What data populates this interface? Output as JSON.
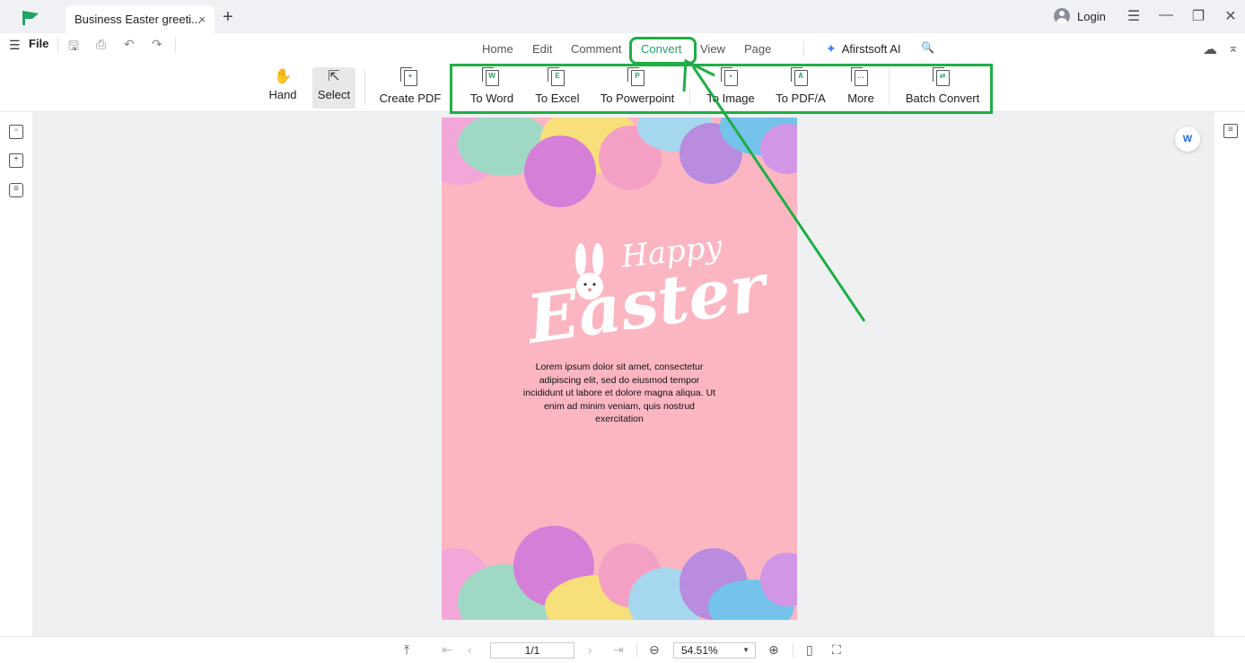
{
  "tab": {
    "title": "Business Easter greeti...",
    "close": "×"
  },
  "titlebar": {
    "new_tab": "+",
    "login": "Login",
    "menu": "☰",
    "minimize": "—",
    "restore": "❐",
    "close": "✕"
  },
  "menubar": {
    "hamburger": "☰",
    "file": "File",
    "save": "🖫",
    "print": "⎙",
    "undo": "↶",
    "redo": "↷",
    "nav": [
      "Home",
      "Edit",
      "Comment",
      "Convert",
      "View",
      "Page"
    ],
    "active_nav": "Convert",
    "ai": "Afirstsoft AI",
    "search": "🔍",
    "cloud": "☁",
    "collapse": "⌅"
  },
  "toolbar": {
    "hand": "Hand",
    "select": "Select",
    "create_pdf": "Create PDF",
    "to_word": "To Word",
    "to_excel": "To Excel",
    "to_powerpoint": "To Powerpoint",
    "to_image": "To Image",
    "to_pdfa": "To PDF/A",
    "more": "More",
    "batch_convert": "Batch Convert"
  },
  "icons": {
    "hand": "hand-icon",
    "select": "cursor-icon"
  },
  "document": {
    "happy": "Happy",
    "easter": "Easter",
    "body": "Lorem ipsum dolor sit amet, consectetur adipiscing elit, sed do eiusmod tempor incididunt ut labore et dolore magna aliqua. Ut enim ad minim veniam, quis nostrud exercitation"
  },
  "statusbar": {
    "page": "1/1",
    "zoom": "54.51%"
  },
  "colors": {
    "accent": "#21a366",
    "annotation": "#1fae45",
    "page_bg": "#fcb6c2"
  }
}
